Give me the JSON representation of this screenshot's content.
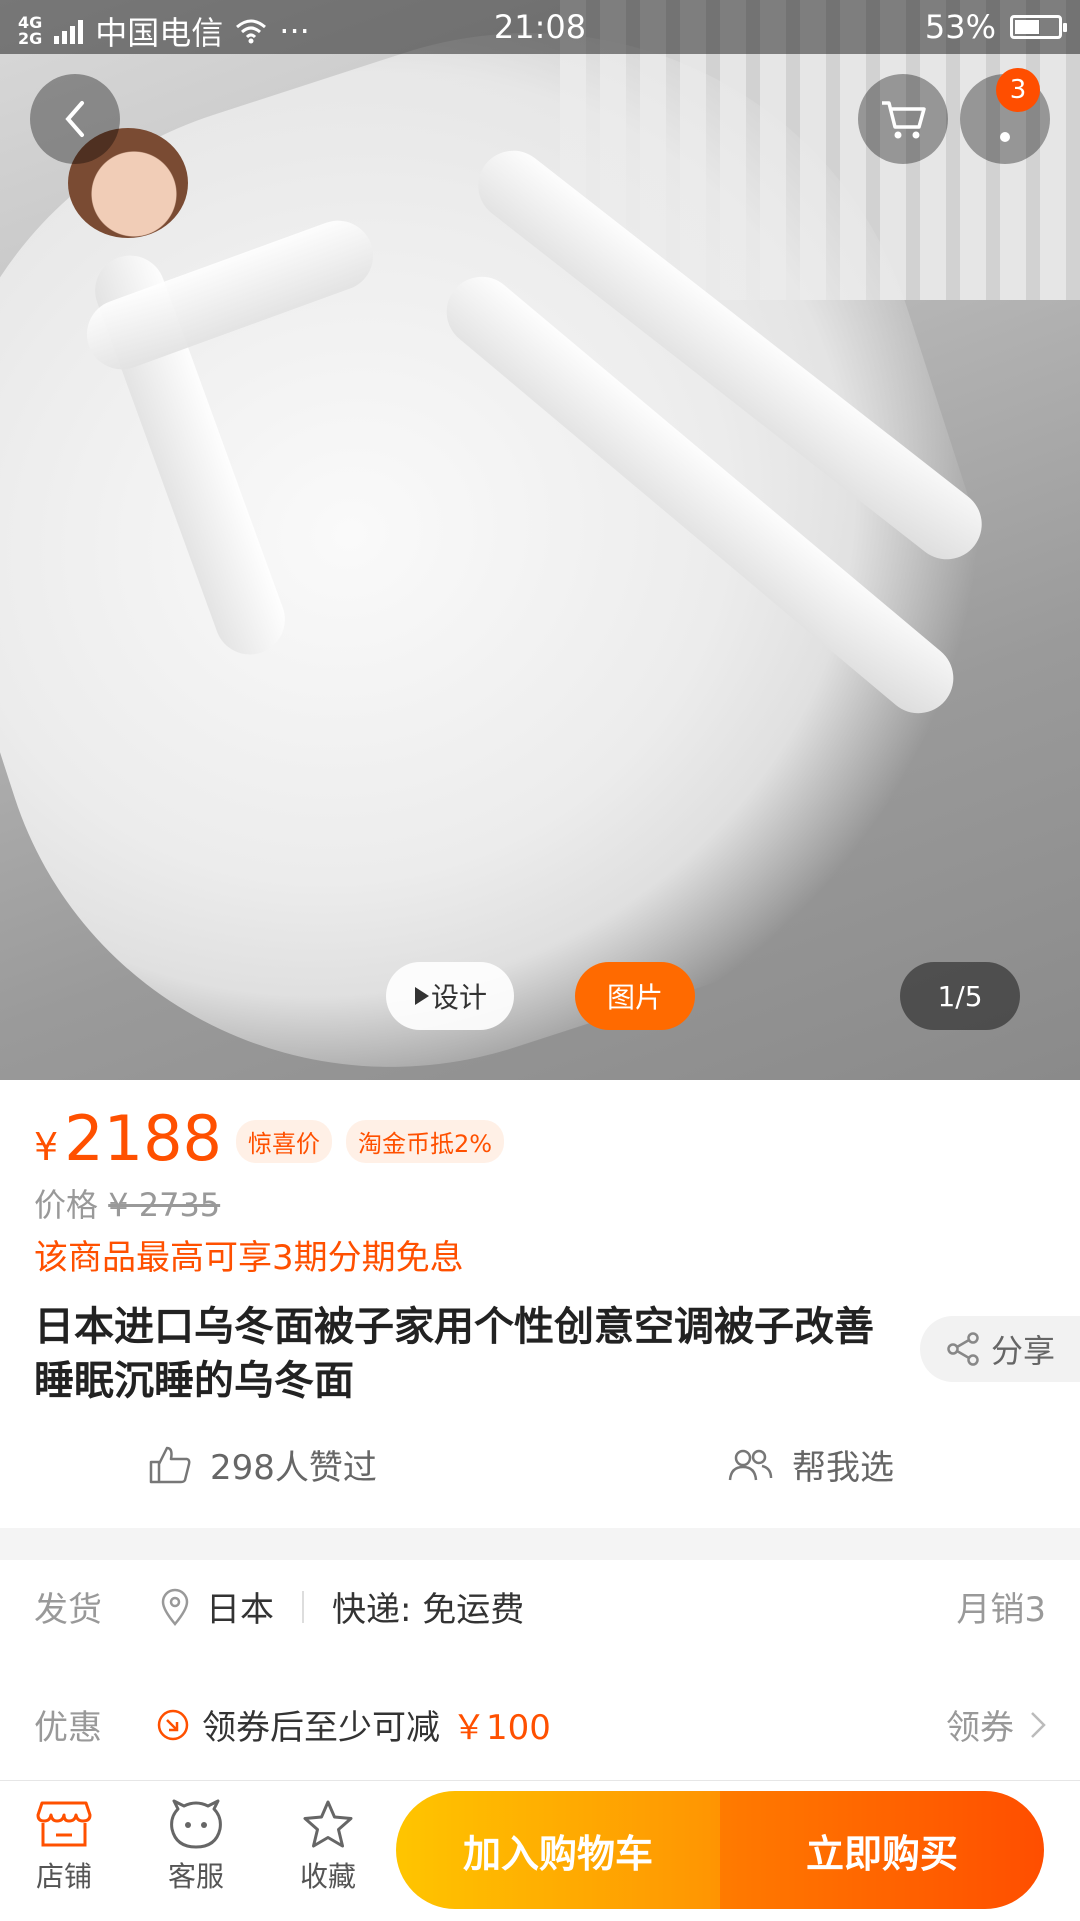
{
  "status": {
    "net_top": "4G",
    "net_bottom": "2G",
    "carrier": "中国电信",
    "dots": "···",
    "time": "21:08",
    "battery": "53%",
    "battery_level": 0.53
  },
  "gallery": {
    "mode_video": "设计",
    "mode_image": "图片",
    "counter": "1/5",
    "cart_badge": "3"
  },
  "product": {
    "currency": "¥",
    "price": "2188",
    "tag_surprise": "惊喜价",
    "tag_coins": "淘金币抵2%",
    "orig_label": "价格",
    "orig_price": "¥ 2735",
    "installment": "该商品最高可享3期分期免息",
    "title": "日本进口乌冬面被子家用个性创意空调被子改善睡眠沉睡的乌冬面",
    "share": "分享",
    "likes": "298人赞过",
    "help_choose": "帮我选"
  },
  "shipping": {
    "label": "发货",
    "location": "日本",
    "express": "快递: 免运费",
    "monthly_sales": "月销3"
  },
  "promo": {
    "label": "优惠",
    "text": "领券后至少可减",
    "amount": "￥100",
    "action": "领券"
  },
  "bottom": {
    "store": "店铺",
    "service": "客服",
    "favorite": "收藏",
    "add_cart": "加入购物车",
    "buy_now": "立即购买"
  },
  "colors": {
    "accent": "#ff5000",
    "cart_gradient_start": "#ffc500",
    "cart_gradient_end": "#ff9402",
    "buy_gradient_start": "#ff7b00",
    "buy_gradient_end": "#ff4e00"
  }
}
